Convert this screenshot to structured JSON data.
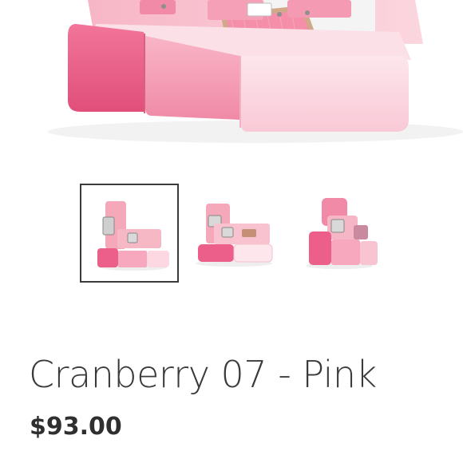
{
  "product": {
    "title": "Cranberry 07 - Pink",
    "price": "$93.00"
  },
  "gallery": {
    "selected_index": 0,
    "images": [
      {
        "name": "pink-platform-sandal-side-view"
      },
      {
        "name": "pink-platform-sandal-front-angle"
      },
      {
        "name": "pink-platform-sandal-back-angle"
      }
    ]
  },
  "colors": {
    "sole_dark": "#ec5f8a",
    "sole_mid": "#f7a8bf",
    "sole_light": "#fbd3de",
    "strap": "#f4a7b9",
    "mesh": "#f58ea8",
    "buckle": "#d9d9d9",
    "text": "#3a3a3a"
  }
}
